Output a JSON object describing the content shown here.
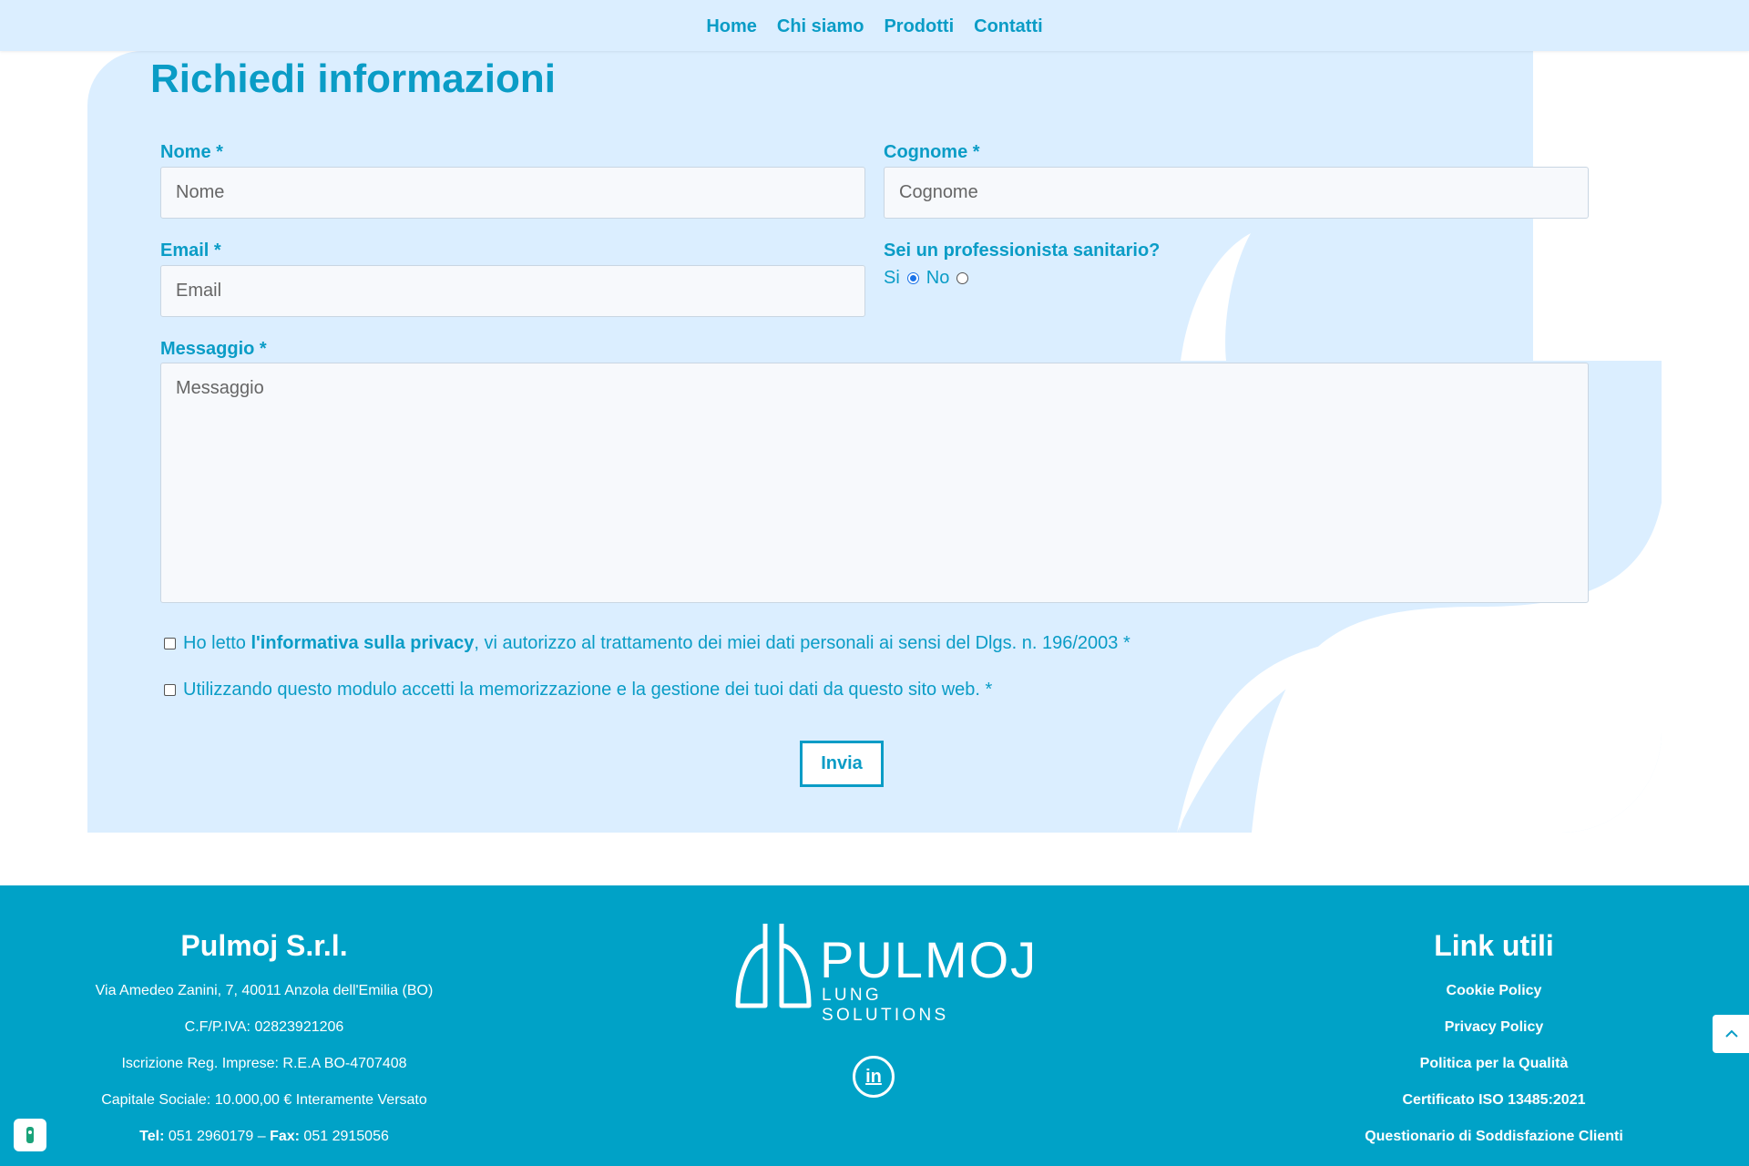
{
  "nav": {
    "items": [
      "Home",
      "Chi siamo",
      "Prodotti",
      "Contatti"
    ]
  },
  "form": {
    "title": "Richiedi informazioni",
    "nome": {
      "label": "Nome *",
      "placeholder": "Nome"
    },
    "cognome": {
      "label": "Cognome *",
      "placeholder": "Cognome"
    },
    "email": {
      "label": "Email *",
      "placeholder": "Email"
    },
    "professional": {
      "question": "Sei un professionista sanitario?",
      "options": [
        "Si",
        "No"
      ],
      "selected": "Si"
    },
    "messaggio": {
      "label": "Messaggio *",
      "placeholder": "Messaggio"
    },
    "privacy": {
      "prefix": "Ho letto ",
      "link": "l'informativa sulla privacy",
      "suffix": ", vi autorizzo al trattamento dei miei dati personali ai sensi del Dlgs. n. 196/2003 *"
    },
    "consent": "Utilizzando questo modulo accetti la memorizzazione e la gestione dei tuoi dati da questo sito web. *",
    "submit": "Invia"
  },
  "footer": {
    "company": {
      "title": "Pulmoj S.r.l.",
      "address": "Via Amedeo Zanini, 7, 40011 Anzola dell'Emilia (BO)",
      "vat": "C.F/P.IVA: 02823921206",
      "rea": "Iscrizione Reg. Imprese: R.E.A BO-4707408",
      "capital": "Capitale Sociale: 10.000,00 € Interamente Versato",
      "tel_label": "Tel:",
      "tel": " 051 2960179 – ",
      "fax_label": "Fax:",
      "fax": " 051 2915056"
    },
    "logo": {
      "word": "PULMOJ",
      "tagline": "LUNG SOLUTIONS"
    },
    "links": {
      "title": "Link utili",
      "items": [
        "Cookie Policy",
        "Privacy Policy",
        "Politica per la Qualità",
        "Certificato ISO 13485:2021",
        "Questionario di Soddisfazione Clienti"
      ]
    },
    "social_icon": "linkedin-icon"
  },
  "colors": {
    "accent": "#0a9cc6",
    "panel": "#dbeeff",
    "footer": "#00a2c7"
  }
}
